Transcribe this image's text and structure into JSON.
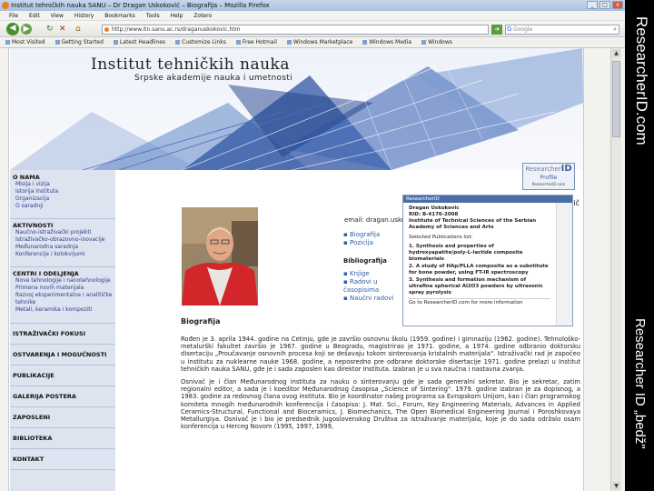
{
  "window": {
    "title": "Institut tehničkih nauka SANU – Dr Dragan Uskoković – Biografija – Mozilla Firefox",
    "controls": [
      "_",
      "□",
      "x"
    ]
  },
  "menu": [
    "File",
    "Edit",
    "View",
    "History",
    "Bookmarks",
    "Tools",
    "Help",
    "Zotero"
  ],
  "nav": {
    "url": "http://www.itn.sanu.ac.rs/draganuskokovic.htm",
    "search_placeholder": "Google"
  },
  "bookmarks": [
    "Most Visited",
    "Getting Started",
    "Latest Headlines",
    "Customize Links",
    "Free Hotmail",
    "Windows Marketplace",
    "Windows Media",
    "Windows"
  ],
  "site": {
    "title": "Institut tehničkih nauka",
    "subtitle": "Srpske akademije nauka i umetnosti"
  },
  "sidebar": {
    "sections": [
      {
        "title": "O NAMA",
        "items": [
          "Misija i vizija",
          "Istorija Instituta",
          "Organizacija",
          "O saradnji"
        ]
      },
      {
        "title": "AKTIVNOSTI",
        "items": [
          "Naučno-istraživački projekti",
          "Istraživačko-obrazovno-inovacije",
          "Međunarodna saradnja",
          "Konferencije i kolokvijumi"
        ]
      },
      {
        "title": "CENTRI I ODELJENJA",
        "items": [
          "Nove tehnologije i nanotehnologije",
          "Primena novih materijala",
          "Razvoj eksperimentalne i analitičke tehnike",
          "Metali, keramika i kompoziti"
        ]
      }
    ],
    "bars": [
      "ISTRAŽIVAČKI FOKUSI",
      "OSTVARENJA I MOGUĆNOSTI",
      "PUBLIKACIJE",
      "GALERIJA POSTERA",
      "ZAPOSLENI",
      "BIBLIOTEKA",
      "KONTAKT"
    ]
  },
  "right_links": {
    "email": "email: dragan.uskokovic@itn.sanu.ac.rs",
    "items1": [
      "Biografija",
      "Pozicija"
    ],
    "biblio_heading": "Bibliografija",
    "items2": [
      "Knjige",
      "Radovi u časopisima",
      "Naučni radovi"
    ]
  },
  "rid_button": {
    "label1": "Researcher",
    "label2": "ID",
    "label3": "Profile",
    "label4": "ResearcherID.com"
  },
  "ric": "rič",
  "popup": {
    "header": "ResearcherID",
    "name": "Dragan Uskokovic",
    "rid": "RID: B-4176-2008",
    "inst": "Institute of Technical Sciences of the Serbian Academy of Sciences and Arts",
    "recent": "Selected Publications list:",
    "pubs": [
      "1. Synthesis and properties of hydroxyapatite/poly-L-lactide composite biomaterials",
      "2. A study of HAp/PLLA composite as a substitute for bone powder, using FT-IR spectroscopy",
      "3. Synthesis and formation mechanism of ultrafine spherical Al2O3 powders by ultrasonic spray pyrolysis"
    ],
    "link": "Go to ResearcherID.com for more information"
  },
  "bio": {
    "heading": "Biografija",
    "p1": "Rođen je 3. aprila 1944. godine na Cetinju, gde je završio osnovnu školu (1959. godine) i gimnaziju (1962. godine). Tehnološko-metalurški fakultet završio je 1967. godine u Beogradu, magistrirao je 1971. godine, a 1974. godine odbranio doktorsku disertaciju „Proučavanje osnovnih procesa koji se dešavaju tokom sinterovanja kristalnih materijala\". Istraživački rad je započeo u institutu za nuklearne nauke 1968. godine, a neposredno pre odbrane doktorske disertacije 1971. godine prelazi u Institut tehničkih nauka SANU, gde je i sada zaposlen kao direktor Instituta. Izabran je u sva naučna i nastavna zvanja.",
    "p2": "Osnivač je i član Međunarodnog instituta za nauku o sinterovanju gde je sada generalni sekretar. Bio je sekretar, zatim regionalni editor, a sada je i koeditor Međunarodnog časopisa „Science of Sintering\". 1979. godine izabran je za dopisnog, a 1983. godine za redovnog člana ovog instituta. Bio je koordinator našeg programa sa Evropskom Unijom, kao i član programskog komiteta mnogih međunarodnih konferencija i časopisa: J. Mat. Sci., Forum, Key Engineering Materials, Advances in Applied Ceramics-Structural, Functional and Bioceramics, J. Biomechanics, The Open Biomedical Engineering Journal i Poroshkovaya Metallurgiya. Osnivač je i bio je predsednik Jugoslovenskog Društva za istraživanje materijala, koje je do sada održalo osam konferencija u Herceg Novom (1995, 1997, 1999,"
  },
  "slide_labels": {
    "top": "ResearcherID.com",
    "bottom": "Researcher ID „bedž\""
  }
}
